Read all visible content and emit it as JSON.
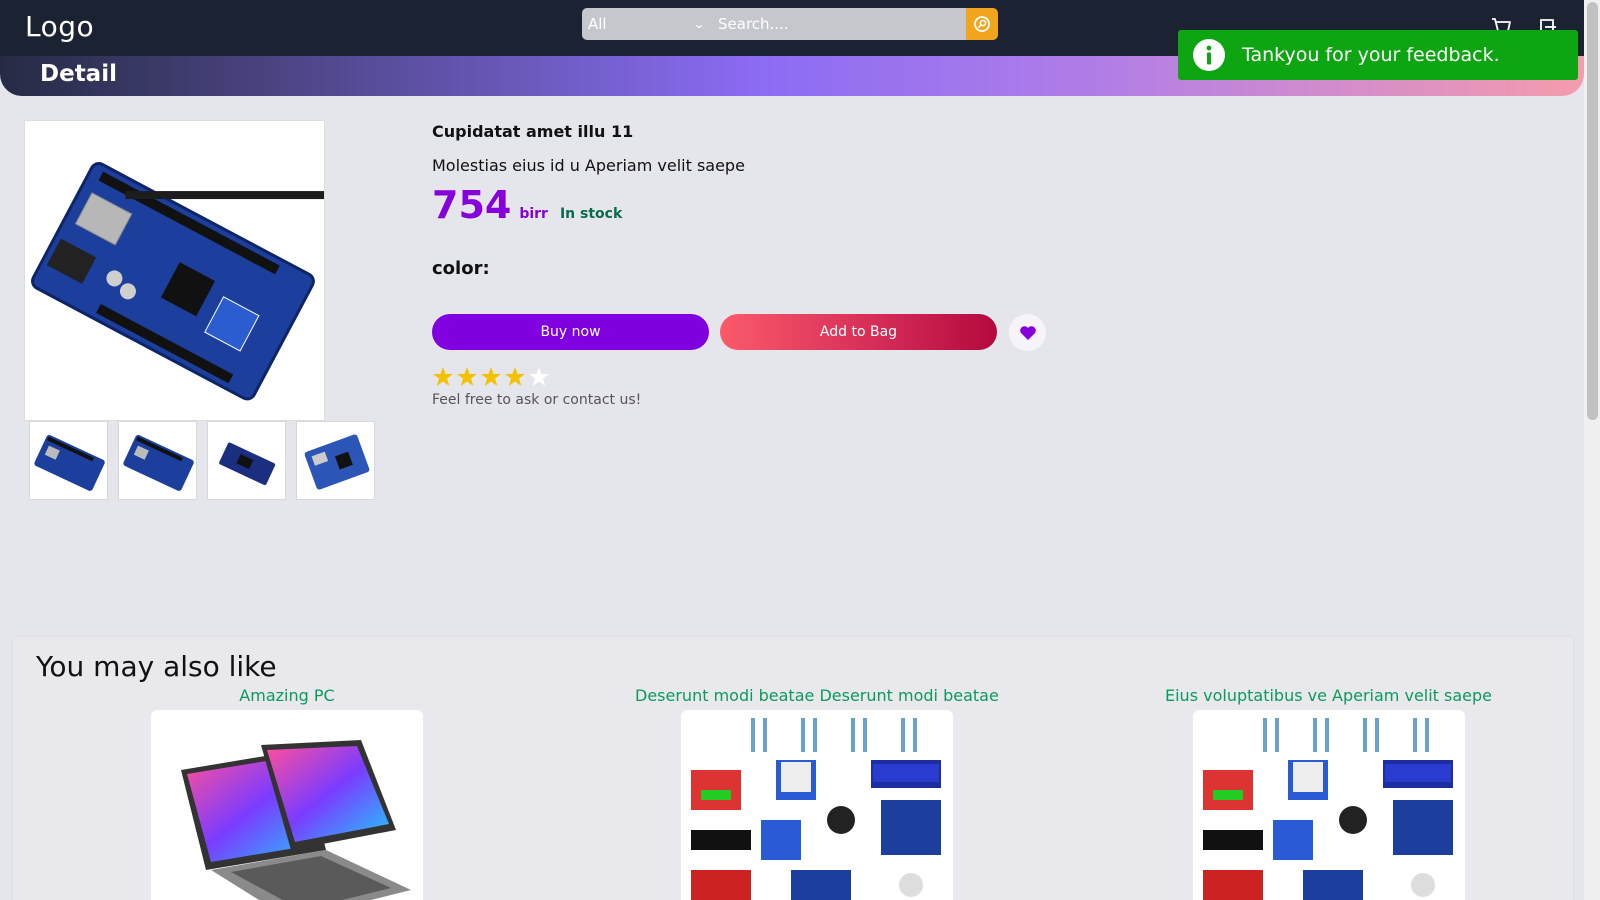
{
  "header": {
    "logo": "Logo",
    "search": {
      "category": "All",
      "placeholder": "Search...."
    },
    "icons": [
      "cart-icon",
      "user-icon"
    ]
  },
  "banner": {
    "title": "Detail"
  },
  "toast": {
    "message": "Tankyou for your feedback.",
    "icon": "info-icon",
    "color": "#0ea512"
  },
  "product": {
    "title": "Cupidatat amet illu 11",
    "description": "Molestias eius id u Aperiam velit saepe",
    "price": "754",
    "currency": "birr",
    "stock": "In stock",
    "color_label": "color:",
    "buy_label": "Buy now",
    "bag_label": "Add to Bag",
    "rating": 4,
    "rating_max": 5,
    "contact": "Feel free to ask or contact us!",
    "thumbnails": [
      "uno-board",
      "uno-board",
      "mega-board",
      "uno-board"
    ]
  },
  "recommendations": {
    "heading": "You may also like",
    "items": [
      {
        "name": "Amazing PC"
      },
      {
        "name": "Deserunt modi beatae Deserunt modi beatae"
      },
      {
        "name": "Eius voluptatibus ve Aperiam velit saepe"
      }
    ]
  },
  "colors": {
    "accent": "#8500d9",
    "topbar": "#1b2232",
    "stock": "#0a6b4a",
    "link": "#0b9b5c"
  }
}
